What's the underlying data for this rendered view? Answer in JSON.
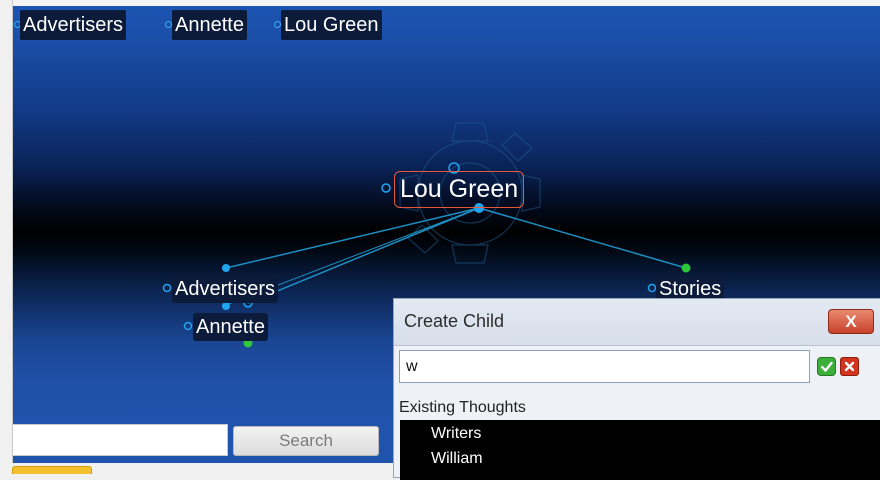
{
  "breadcrumbs": [
    "Advertisers",
    "Annette",
    "Lou Green"
  ],
  "active_thought": "Lou Green",
  "thoughts": {
    "parents": [
      "Advertisers",
      "Annette"
    ],
    "children": [
      "Stories"
    ]
  },
  "search": {
    "value": "",
    "button_label": "Search"
  },
  "dialog": {
    "title": "Create Child",
    "close_label": "X",
    "input_value": "w",
    "confirm_icon": "check-icon",
    "cancel_icon": "x-icon",
    "existing_label": "Existing Thoughts",
    "existing_items": [
      "Writers",
      "William"
    ]
  },
  "colors": {
    "background_top": "#1d55b4",
    "background_mid": "#000000",
    "link_line": "#1d8fc2",
    "node_dot": "#21a5f0",
    "child_dot": "#2ec63a",
    "active_border": "#e55a3b"
  }
}
